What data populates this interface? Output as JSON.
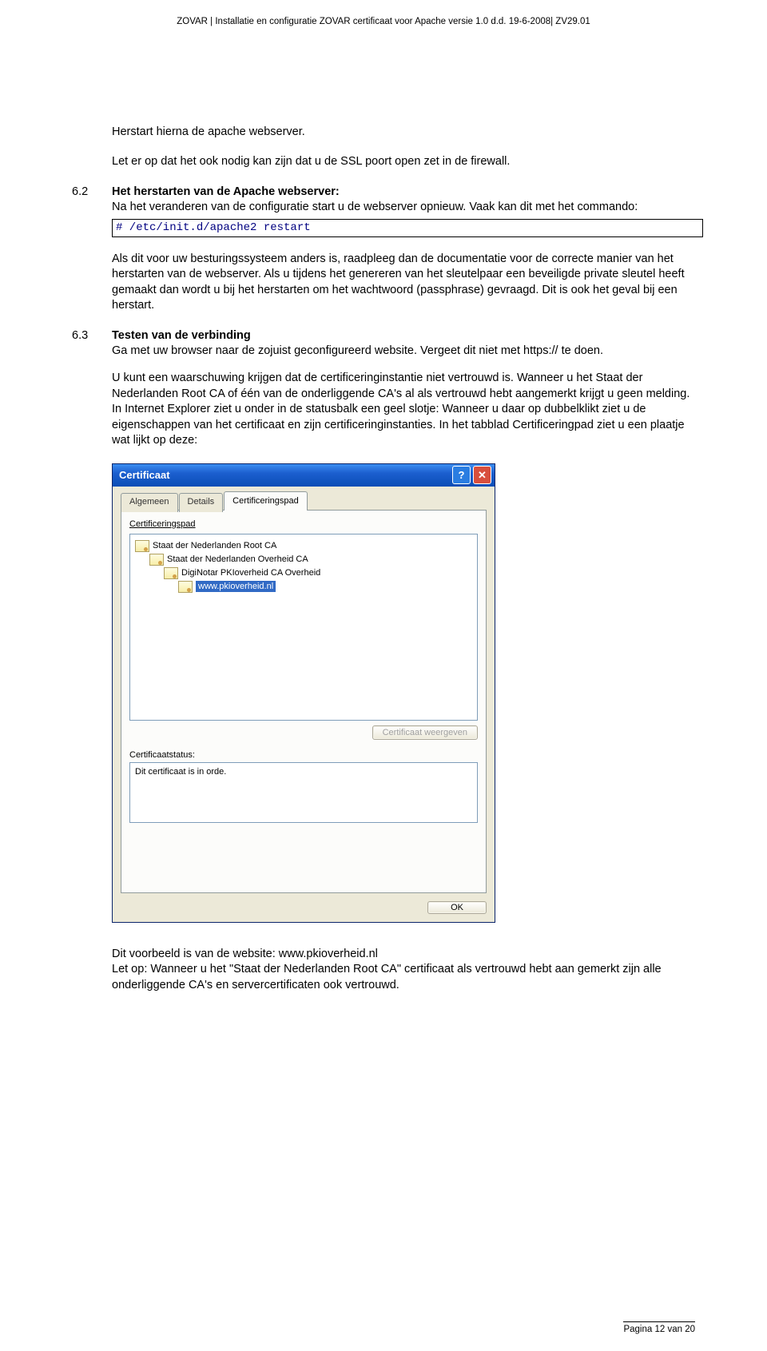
{
  "header": "ZOVAR | Installatie en configuratie ZOVAR certificaat voor Apache versie 1.0 d.d. 19-6-2008| ZV29.01",
  "intro": {
    "line1": "Herstart hierna de apache webserver.",
    "line2": "Let er op dat het ook nodig kan zijn dat u de SSL poort open zet in de firewall."
  },
  "s62": {
    "num": "6.2",
    "title": "Het herstarten van de Apache webserver:",
    "body1": "Na het veranderen van de configuratie start u de webserver opnieuw. Vaak kan dit met het commando:",
    "code": "# /etc/init.d/apache2 restart",
    "body2": "Als dit voor uw besturingssysteem anders is, raadpleeg dan de documentatie voor de correcte manier van het herstarten van de webserver. Als u tijdens het genereren van het sleutelpaar een beveiligde private sleutel heeft gemaakt dan wordt u bij het herstarten om het wachtwoord (passphrase) gevraagd. Dit is ook het geval bij een herstart."
  },
  "s63": {
    "num": "6.3",
    "title": "Testen van de verbinding",
    "body1": "Ga met uw browser naar de zojuist geconfigureerd website. Vergeet dit niet met https:// te doen.",
    "body2": "U kunt een waarschuwing krijgen dat de certificeringinstantie niet vertrouwd is. Wanneer u het Staat der Nederlanden Root CA of één van de onderliggende CA's al als vertrouwd hebt aangemerkt krijgt u geen melding. In Internet Explorer ziet u onder in de statusbalk een geel slotje: Wanneer u daar op dubbelklikt ziet u de eigenschappen van het certificaat en zijn certificeringinstanties. In het tabblad Certificeringpad ziet u een plaatje wat lijkt op deze:"
  },
  "dialog": {
    "title": "Certificaat",
    "help_glyph": "?",
    "close_glyph": "✕",
    "tabs": {
      "general": "Algemeen",
      "details": "Details",
      "path": "Certificeringspad"
    },
    "group_label": "Certificeringspad",
    "tree": [
      "Staat der Nederlanden Root CA",
      "Staat der Nederlanden Overheid CA",
      "DigiNotar PKIoverheid CA Overheid",
      "www.pkioverheid.nl"
    ],
    "view_cert_btn": "Certificaat weergeven",
    "status_label": "Certificaatstatus:",
    "status_text": "Dit certificaat is in orde.",
    "ok_btn": "OK"
  },
  "outro": {
    "line1": "Dit voorbeeld is van de website: www.pkioverheid.nl",
    "line2": "Let op: Wanneer u het \"Staat der Nederlanden Root CA\" certificaat als vertrouwd hebt aan gemerkt zijn alle onderliggende CA's en servercertificaten ook vertrouwd."
  },
  "footer": "Pagina 12 van 20"
}
